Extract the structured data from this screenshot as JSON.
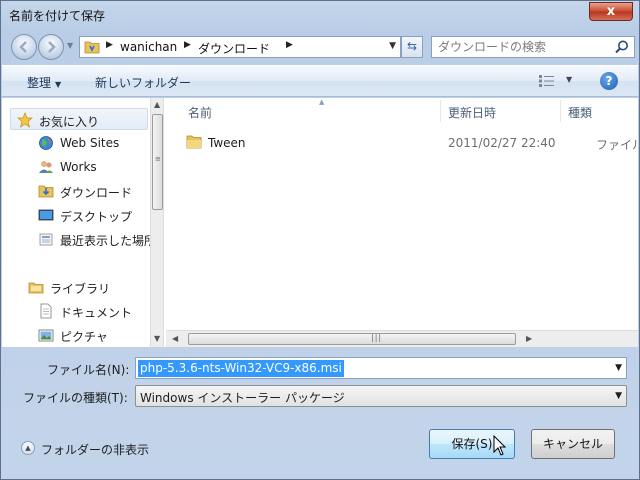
{
  "window": {
    "title": "名前を付けて保存",
    "close_label": "x"
  },
  "address": {
    "segments": [
      "wanichan",
      "ダウンロード"
    ]
  },
  "search": {
    "placeholder": "ダウンロードの検索"
  },
  "toolbar": {
    "organize_label": "整理",
    "new_folder_label": "新しいフォルダー",
    "help_label": "?"
  },
  "sidebar": {
    "items": [
      {
        "label": "お気に入り",
        "icon": "star-icon"
      },
      {
        "label": "Web Sites",
        "icon": "globe-icon"
      },
      {
        "label": "Works",
        "icon": "people-icon"
      },
      {
        "label": "ダウンロード",
        "icon": "download-folder-icon"
      },
      {
        "label": "デスクトップ",
        "icon": "desktop-icon"
      },
      {
        "label": "最近表示した場所",
        "icon": "recent-places-icon"
      },
      {
        "label": "ライブラリ",
        "icon": "library-icon"
      },
      {
        "label": "ドキュメント",
        "icon": "document-icon"
      },
      {
        "label": "ピクチャ",
        "icon": "picture-icon"
      }
    ]
  },
  "columns": {
    "name": "名前",
    "date": "更新日時",
    "type": "種類"
  },
  "files": [
    {
      "name": "Tween",
      "date": "2011/02/27 22:40",
      "type": "ファイル フォルダー"
    }
  ],
  "form": {
    "filename_label": "ファイル名(N):",
    "filename_value": "php-5.3.6-nts-Win32-VC9-x86.msi",
    "filetype_label": "ファイルの種類(T):",
    "filetype_value": "Windows インストーラー パッケージ"
  },
  "footer": {
    "hide_folders_label": "フォルダーの非表示",
    "save_label": "保存(S)",
    "cancel_label": "キャンセル"
  }
}
